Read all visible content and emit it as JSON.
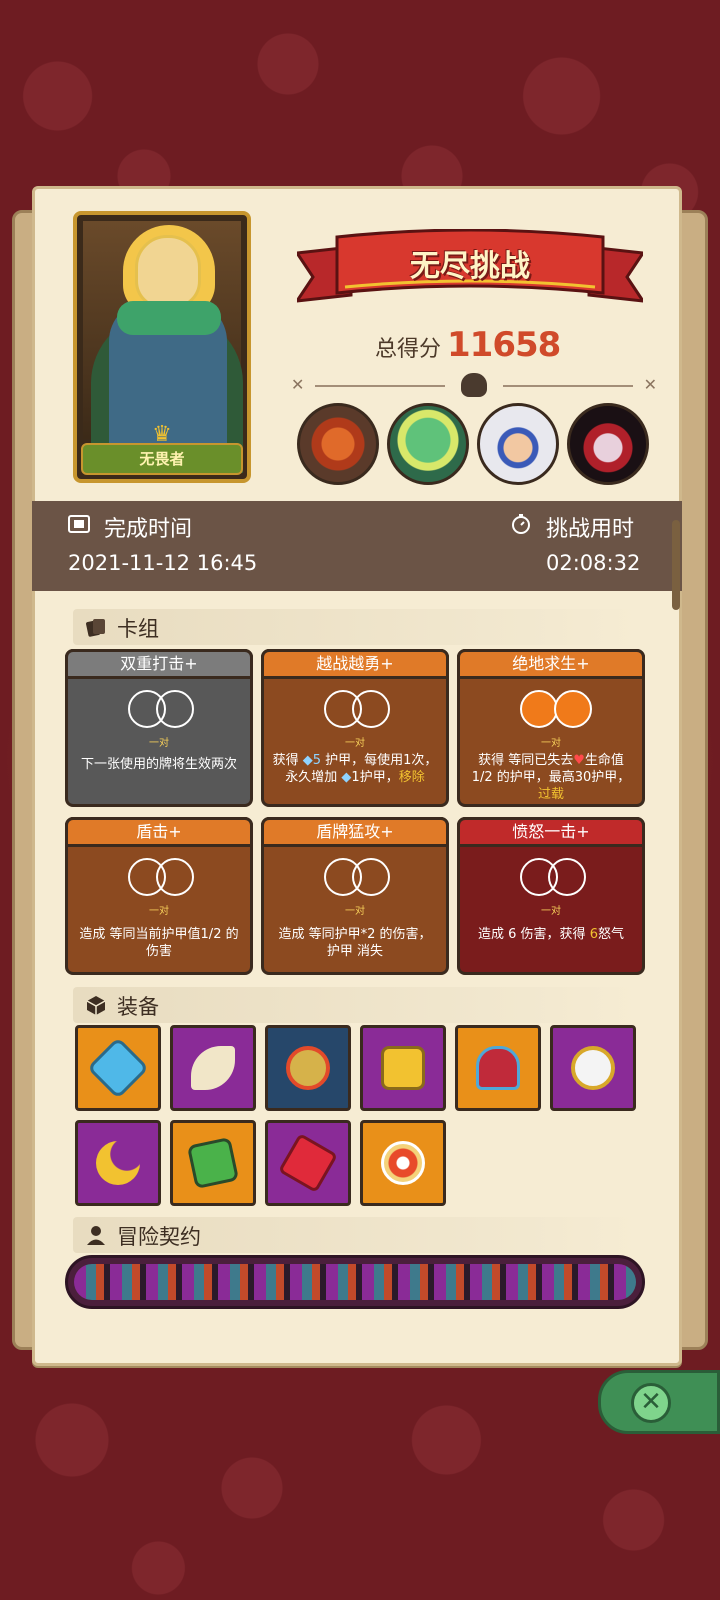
{
  "hero": {
    "name": "无畏者"
  },
  "banner": {
    "title": "无尽挑战"
  },
  "score": {
    "label": "总得分",
    "value": "11658"
  },
  "bosses": [
    "boss-cyclops",
    "boss-frog",
    "boss-yeti",
    "boss-vampire"
  ],
  "info": {
    "completion_label": "完成时间",
    "completion_value": "2021-11-12 16:45",
    "duration_label": "挑战用时",
    "duration_value": "02:08:32"
  },
  "sections": {
    "deck": "卡组",
    "equipment": "装备",
    "contracts": "冒险契约"
  },
  "cards": [
    {
      "title": "双重打击+",
      "pair": "一对",
      "desc": "下一张使用的牌将生效两次"
    },
    {
      "title": "越战越勇+",
      "pair": "一对",
      "desc_a": "获得 ",
      "desc_b": "5",
      "desc_c": " 护甲，每使用1次，永久增加 ",
      "desc_d": "1护甲，",
      "desc_e": "移除"
    },
    {
      "title": "绝地求生+",
      "pair": "一对",
      "desc_a": "获得 等同已失去",
      "desc_b": "生命值1/2 的护甲，最高30护甲，",
      "desc_c": "过载"
    },
    {
      "title": "盾击+",
      "pair": "一对",
      "desc": "造成 等同当前护甲值1/2 的伤害"
    },
    {
      "title": "盾牌猛攻+",
      "pair": "一对",
      "desc": "造成 等同护甲*2 的伤害，护甲 消失"
    },
    {
      "title": "愤怒一击+",
      "pair": "一对",
      "desc_a": "造成 6 伤害，获得 ",
      "desc_b": "6",
      "desc_c": "怒气"
    }
  ],
  "equipment": [
    "shield-gem-icon",
    "claws-icon",
    "armor-compass-icon",
    "golden-box-icon",
    "crowned-shield-icon",
    "mirror-icon",
    "crescent-moon-icon",
    "green-tome-icon",
    "red-crystal-icon",
    "orange-medallion-icon"
  ],
  "colors": {
    "accent_score": "#d04a2a",
    "panel": "#f6ecd3",
    "background": "#6e1c22"
  }
}
